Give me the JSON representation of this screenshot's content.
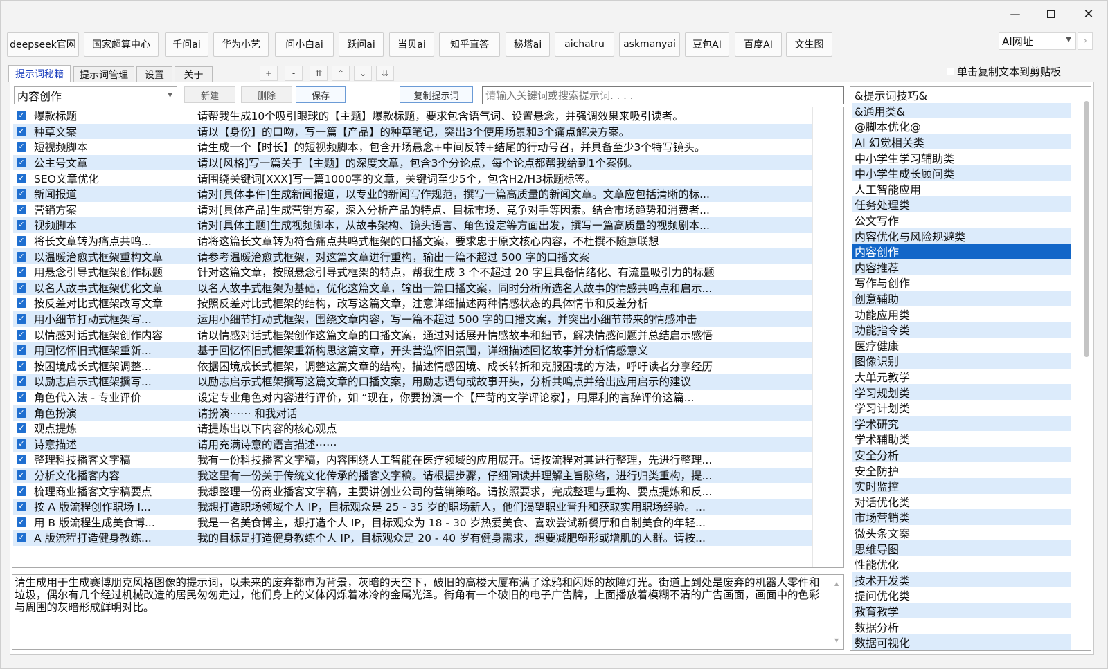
{
  "window": {
    "min_glyph": "—",
    "close_glyph": "✕"
  },
  "links": [
    "deepseek官网",
    "国家超算中心",
    "千问ai",
    "华为小艺",
    "问小白ai",
    "跃问ai",
    "当贝ai",
    "知乎直答",
    "秘塔ai",
    "aichatru",
    "askmanyai",
    "豆包AI",
    "百度AI",
    "文生图"
  ],
  "ai_url_combo": {
    "value": "AI网址",
    "next_glyph": "›"
  },
  "tabs": [
    "提示词秘籍",
    "提示词管理",
    "设置",
    "关于"
  ],
  "move_buttons": [
    "+",
    "-",
    "⇈",
    "⌃",
    "⌄",
    "⇊"
  ],
  "copy_option": "单击复制文本到剪贴板",
  "category_select": "内容创作",
  "toolbar": {
    "new": "新建",
    "delete": "删除",
    "save": "保存",
    "copy": "复制提示词"
  },
  "search": {
    "placeholder": "请输入关键词或搜索提示词. . . ."
  },
  "prompts": [
    {
      "name": "爆款标题",
      "text": "请帮我生成10个吸引眼球的【主题】爆款标题，要求包含语气词、设置悬念，并强调效果来吸引读者。"
    },
    {
      "name": "种草文案",
      "text": "请以【身份】的口吻，写一篇【产品】的种草笔记，突出3个使用场景和3个痛点解决方案。"
    },
    {
      "name": "短视频脚本",
      "text": "请生成一个【时长】的短视频脚本，包含开场悬念+中间反转+结尾的行动号召，并具备至少3个特写镜头。"
    },
    {
      "name": "公主号文章",
      "text": "请以[风格]写一篇关于【主题】的深度文章，包含3个分论点，每个论点都帮我给到1个案例。"
    },
    {
      "name": "SEO文章优化",
      "text": "请围绕关键词[XXX]写一篇1000字的文章，关键词至少5个，包含H2/H3标题标签。"
    },
    {
      "name": "新闻报道",
      "text": "请对[具体事件]生成新闻报道，以专业的新闻写作规范，撰写一篇高质量的新闻文章。文章应包括清晰的标..."
    },
    {
      "name": "营销方案",
      "text": "请对[具体产品]生成营销方案，深入分析产品的特点、目标市场、竞争对手等因素。结合市场趋势和消费者..."
    },
    {
      "name": "视频脚本",
      "text": "请对[具体主题]生成视频脚本，从故事架构、镜头语言、角色设定等方面出发，撰写一篇高质量的视频剧本..."
    },
    {
      "name": "将长文章转为痛点共鸣...",
      "text": "请将这篇长文章转为符合痛点共鸣式框架的口播文案，要求忠于原文核心内容，不杜撰不随意联想"
    },
    {
      "name": "以温暖治愈式框架重构文章",
      "text": "请参考温暖治愈式框架，对这篇文章进行重构，输出一篇不超过 500 字的口播文案"
    },
    {
      "name": "用悬念引导式框架创作标题",
      "text": "针对这篇文章，按照悬念引导式框架的特点，帮我生成 3 个不超过 20 字且具备情绪化、有流量吸引力的标题"
    },
    {
      "name": "以名人故事式框架优化文章",
      "text": "以名人故事式框架为基础，优化这篇文章，输出一篇口播文案，同时分析所选名人故事的情感共鸣点和启示..."
    },
    {
      "name": "按反差对比式框架改写文章",
      "text": "按照反差对比式框架的结构，改写这篇文章，注意详细描述两种情感状态的具体情节和反差分析"
    },
    {
      "name": "用小细节打动式框架写...",
      "text": "运用小细节打动式框架，围绕文章内容，写一篇不超过 500 字的口播文案，并突出小细节带来的情感冲击"
    },
    {
      "name": "以情感对话式框架创作内容",
      "text": "请以情感对话式框架创作这篇文章的口播文案，通过对话展开情感故事和细节，解决情感问题并总结启示感悟"
    },
    {
      "name": "用回忆怀旧式框架重新...",
      "text": "基于回忆怀旧式框架重新构思这篇文章，开头营造怀旧氛围，详细描述回忆故事并分析情感意义"
    },
    {
      "name": "按困境成长式框架调整...",
      "text": "依据困境成长式框架，调整这篇文章的结构，描述情感困境、成长转折和克服困境的方法，呼吁读者分享经历"
    },
    {
      "name": "以励志启示式框架撰写...",
      "text": "以励志启示式框架撰写这篇文章的口播文案，用励志语句或故事开头，分析共鸣点并给出应用启示的建议"
    },
    {
      "name": "角色代入法 - 专业评价",
      "text": "设定专业角色对内容进行评价，如 “现在，你要扮演一个【严苛的文学评论家】，用犀利的言辞评价这篇..."
    },
    {
      "name": "角色扮演",
      "text": "请扮演⋯⋯ 和我对话"
    },
    {
      "name": "观点提炼",
      "text": "请提炼出以下内容的核心观点"
    },
    {
      "name": "诗意描述",
      "text": "请用充满诗意的语言描述⋯⋯"
    },
    {
      "name": "整理科技播客文字稿",
      "text": "我有一份科技播客文字稿，内容围绕人工智能在医疗领域的应用展开。请按流程对其进行整理，先进行整理..."
    },
    {
      "name": "分析文化播客内容",
      "text": "我这里有一份关于传统文化传承的播客文字稿。请根据步骤，仔细阅读并理解主旨脉络，进行归类重构，提..."
    },
    {
      "name": "梳理商业播客文字稿要点",
      "text": "我想整理一份商业播客文字稿，主要讲创业公司的营销策略。请按照要求，完成整理与重构、要点提炼和反..."
    },
    {
      "name": "按 A 版流程创作职场 I...",
      "text": "我想打造职场领域个人 IP，目标观众是 25 - 35 岁的职场新人，他们渴望职业晋升和获取实用职场经验。..."
    },
    {
      "name": "用 B 版流程生成美食博...",
      "text": "我是一名美食博主，想打造个人 IP，目标观众为 18 - 30 岁热爱美食、喜欢尝试新餐厅和自制美食的年轻..."
    },
    {
      "name": "A 版流程打造健身教练...",
      "text": "我的目标是打造健身教练个人 IP，目标观众是 20 - 40 岁有健身需求，想要减肥塑形或增肌的人群。请按..."
    }
  ],
  "detail_text": "请生成用于生成赛博朋克风格图像的提示词，以未来的废弃都市为背景，灰暗的天空下，破旧的高楼大厦布满了涂鸦和闪烁的故障灯光。街道上到处是废弃的机器人零件和垃圾，偶尔有几个经过机械改造的居民匆匆走过，他们身上的义体闪烁着冰冷的金属光泽。街角有一个破旧的电子广告牌，上面播放着模糊不清的广告画面，画面中的色彩与周围的灰暗形成鲜明对比。",
  "categories": [
    "&提示词技巧&",
    "&通用类&",
    "@脚本优化@",
    "AI 幻觉相关类",
    "中小学生学习辅助类",
    "中小学生成长顾问类",
    "人工智能应用",
    "任务处理类",
    "公文写作",
    "内容优化与风险规避类",
    "内容创作",
    "内容推荐",
    "写作与创作",
    "创意辅助",
    "功能应用类",
    "功能指令类",
    "医疗健康",
    "图像识别",
    "大单元教学",
    "学习规划类",
    "学习计划类",
    "学术研究",
    "学术辅助类",
    "安全分析",
    "安全防护",
    "实时监控",
    "对话优化类",
    "市场营销类",
    "微头条文案",
    "思维导图",
    "性能优化",
    "技术开发类",
    "提问优化类",
    "教育教学",
    "数据分析",
    "数据可视化"
  ],
  "selected_category_index": 10,
  "colors": {
    "row_alt": "#dcebfb",
    "selected": "#1266c8",
    "checkbox": "#1f6fd0",
    "tab_active_text": "#1b3fbf"
  }
}
